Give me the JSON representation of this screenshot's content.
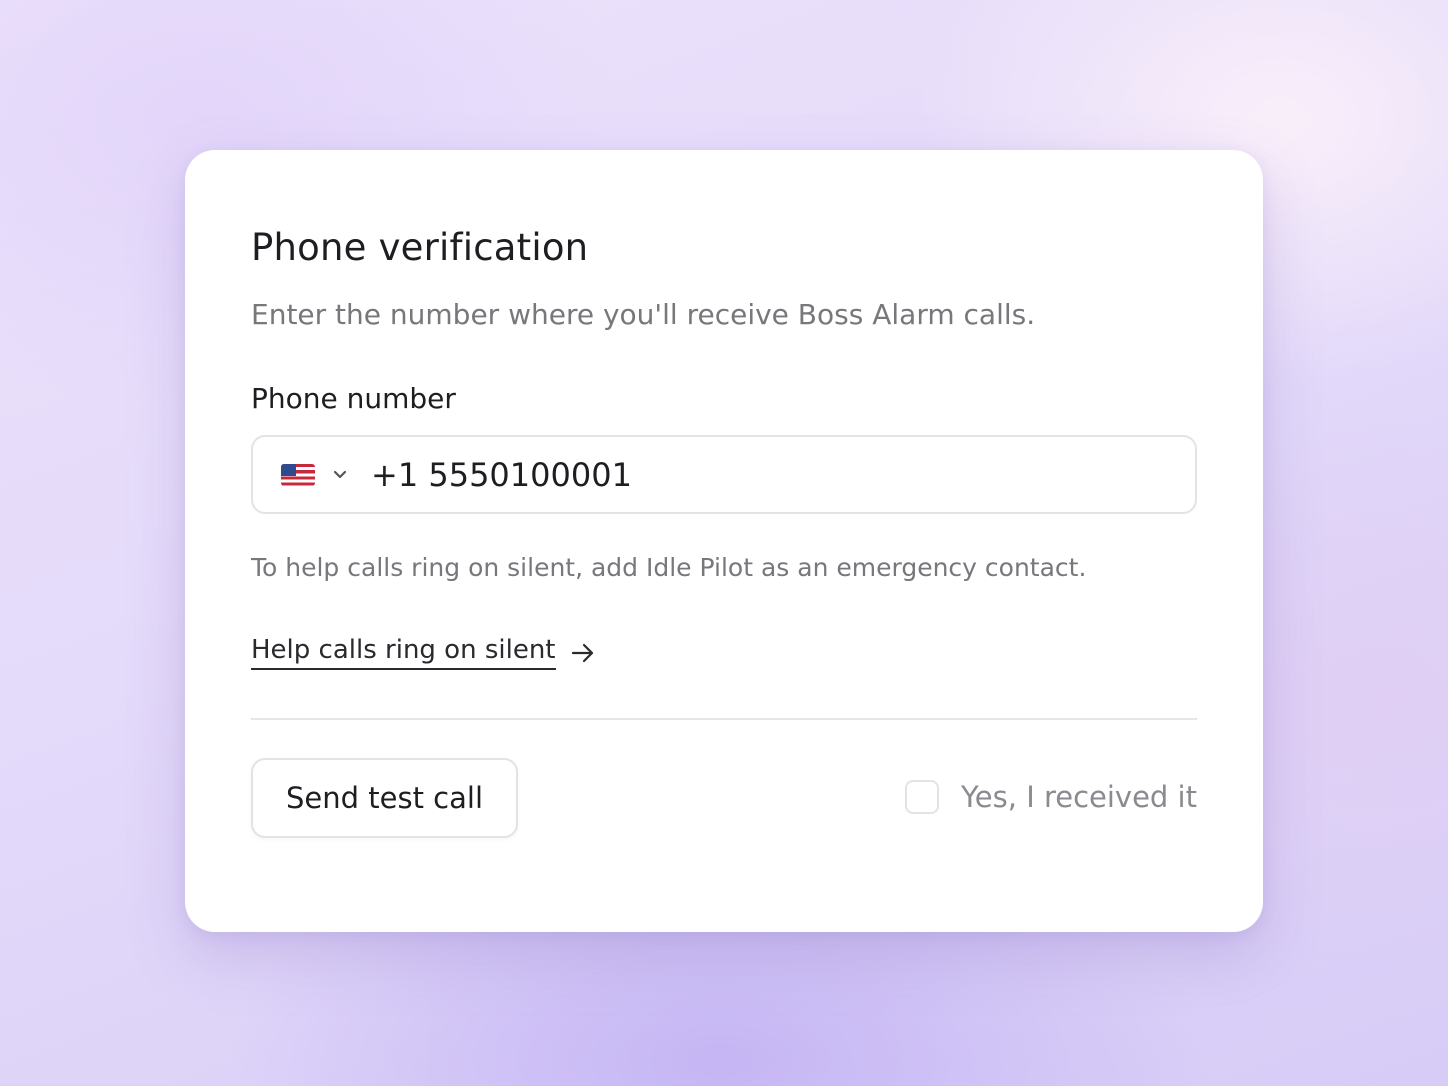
{
  "card": {
    "title": "Phone verification",
    "subtitle": "Enter the number where you'll receive Boss Alarm calls."
  },
  "phone_field": {
    "label": "Phone number",
    "country_flag": "us-flag-icon",
    "value": "+1 5550100001"
  },
  "hint": "To help calls ring on silent, add Idle Pilot as an emergency contact.",
  "help_link": {
    "label": "Help calls ring on silent",
    "icon": "arrow-right-icon"
  },
  "actions": {
    "test_call_label": "Send test call",
    "received_label": "Yes, I received it",
    "received_checked": false
  },
  "colors": {
    "text_primary": "#1e1e22",
    "text_secondary": "#77777c",
    "border": "#e3e3e6"
  }
}
